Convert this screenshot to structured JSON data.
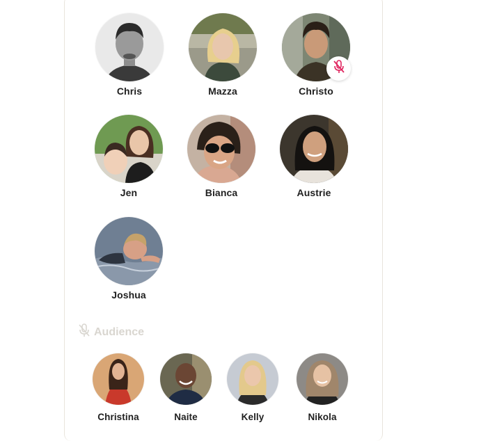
{
  "speakers": [
    {
      "name": "Chris",
      "muted": false
    },
    {
      "name": "Mazza",
      "muted": false
    },
    {
      "name": "Christo",
      "muted": true
    },
    {
      "name": "Jen",
      "muted": false
    },
    {
      "name": "Bianca",
      "muted": false
    },
    {
      "name": "Austrie",
      "muted": false
    },
    {
      "name": "Joshua",
      "muted": false
    }
  ],
  "audience_section": {
    "label": "Audience",
    "icon": "microphone-icon"
  },
  "audience": [
    {
      "name": "Christina"
    },
    {
      "name": "Naite"
    },
    {
      "name": "Kelly"
    },
    {
      "name": "Nikola"
    }
  ],
  "colors": {
    "background": "#ffffff",
    "name_text": "#1f1f1f",
    "section_label": "#d9d6d0",
    "mute_icon": "#e0245e"
  }
}
